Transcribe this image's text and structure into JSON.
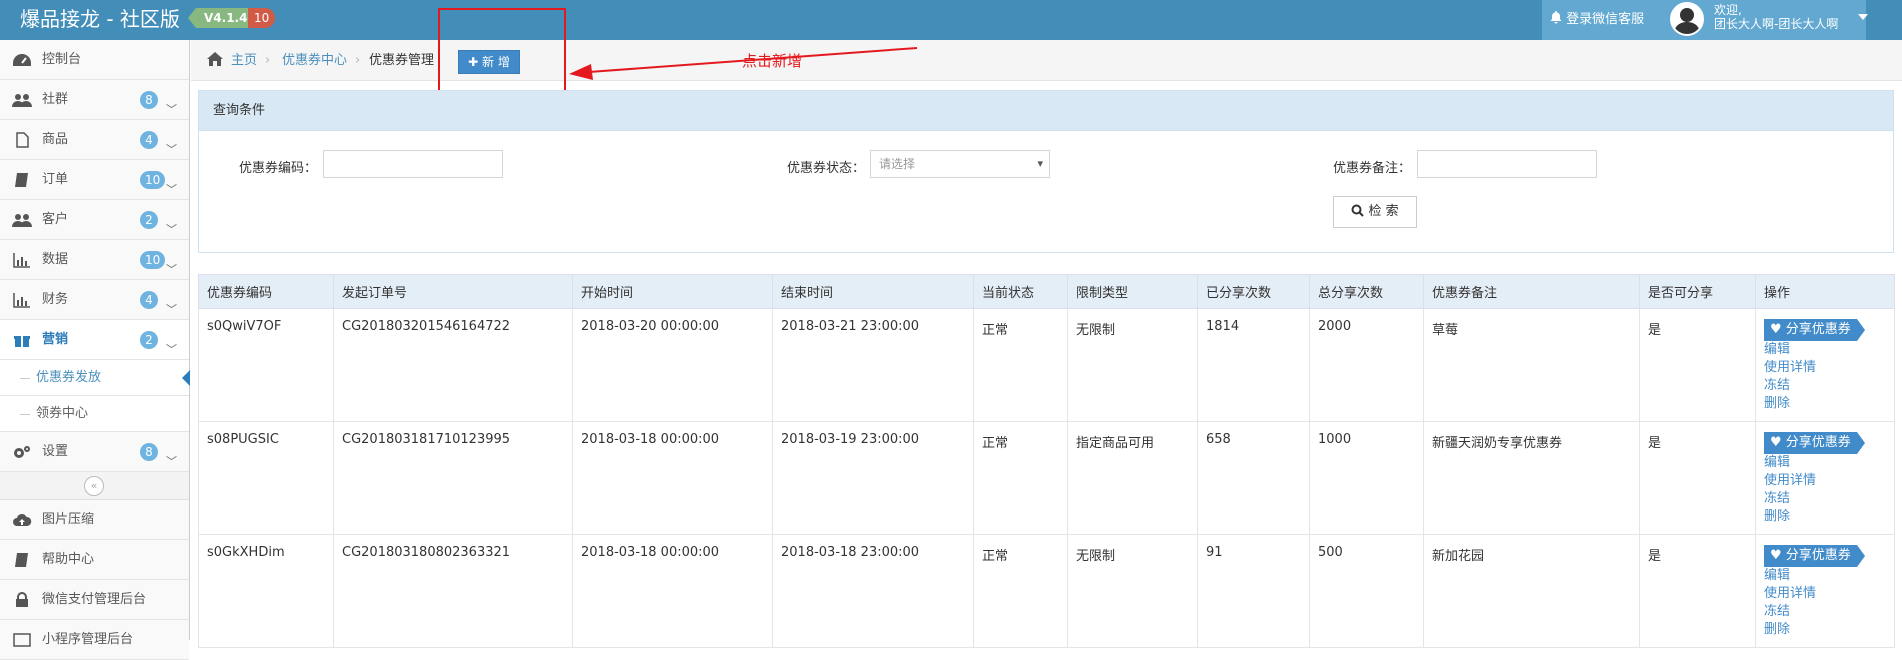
{
  "header": {
    "brand": "爆品接龙 - 社区版",
    "version": "V4.1.4",
    "count": "10",
    "login_service": "登录微信客服",
    "welcome": "欢迎,",
    "username": "团长大人啊-团长大人啊"
  },
  "sidebar": {
    "items": [
      {
        "label": "控制台",
        "icon": "dashboard-icon"
      },
      {
        "label": "社群",
        "badge": "8",
        "icon": "users-icon"
      },
      {
        "label": "商品",
        "badge": "4",
        "icon": "file-icon"
      },
      {
        "label": "订单",
        "badge": "10",
        "icon": "book-icon"
      },
      {
        "label": "客户",
        "badge": "2",
        "icon": "users-icon"
      },
      {
        "label": "数据",
        "badge": "10",
        "icon": "bar-chart-icon"
      },
      {
        "label": "财务",
        "badge": "4",
        "icon": "bar-chart-icon"
      },
      {
        "label": "营销",
        "badge": "2",
        "icon": "gift-icon"
      }
    ],
    "sub_items": [
      "优惠券发放",
      "领券中心"
    ],
    "items2": [
      {
        "label": "设置",
        "badge": "8",
        "icon": "cogs-icon"
      }
    ],
    "items3": [
      {
        "label": "图片压缩",
        "icon": "cloud-upload-icon"
      },
      {
        "label": "帮助中心",
        "icon": "book-icon"
      },
      {
        "label": "微信支付管理后台",
        "icon": "lock-icon"
      },
      {
        "label": "小程序管理后台",
        "icon": "window-icon"
      }
    ]
  },
  "breadcrumb": {
    "home": "主页",
    "center": "优惠券中心",
    "current": "优惠券管理",
    "add": "新 增"
  },
  "annotation": "点击新增",
  "search": {
    "title": "查询条件",
    "code_label": "优惠券编码：",
    "status_label": "优惠券状态：",
    "status_placeholder": "请选择",
    "remark_label": "优惠券备注：",
    "search_button": "检 索"
  },
  "table": {
    "headers": [
      "优惠券编码",
      "发起订单号",
      "开始时间",
      "结束时间",
      "当前状态",
      "限制类型",
      "已分享次数",
      "总分享次数",
      "优惠券备注",
      "是否可分享",
      "操作"
    ],
    "rows": [
      [
        "s0QwiV7OF",
        "CG201803201546164722",
        "2018-03-20 00:00:00",
        "2018-03-21 23:00:00",
        "正常",
        "无限制",
        "1814",
        "2000",
        "草莓",
        "是"
      ],
      [
        "s08PUGSIC",
        "CG201803181710123995",
        "2018-03-18 00:00:00",
        "2018-03-19 23:00:00",
        "正常",
        "指定商品可用",
        "658",
        "1000",
        "新疆天润奶专享优惠券",
        "是"
      ],
      [
        "s0GkXHDim",
        "CG201803180802363321",
        "2018-03-18 00:00:00",
        "2018-03-18 23:00:00",
        "正常",
        "无限制",
        "91",
        "500",
        "新加花园",
        "是"
      ]
    ],
    "actions": {
      "share": "分享优惠券",
      "edit": "编辑",
      "detail": "使用详情",
      "freeze": "冻结",
      "delete": "删除"
    }
  }
}
